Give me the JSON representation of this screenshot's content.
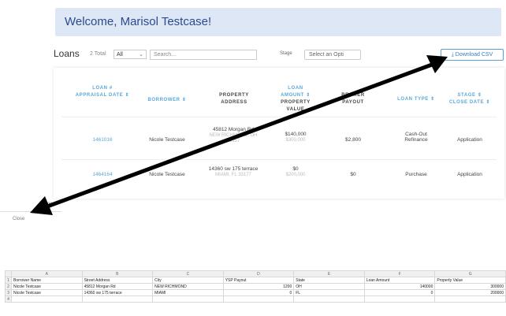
{
  "banner": {
    "welcome": "Welcome, Marisol Testcase!"
  },
  "toolbar": {
    "title": "Loans",
    "total": "2 Total",
    "filter_value": "All",
    "search_placeholder": "Search...",
    "stage_label": "Stage",
    "stage_placeholder": "Select an Opti",
    "download_label": "⤓ Download CSV"
  },
  "table": {
    "headers": [
      {
        "l1": "LOAN #",
        "l2": "APPRAISAL DATE ⇕"
      },
      {
        "l1": "BORROWER ⇕",
        "l2": ""
      },
      {
        "l1": "PROPERTY",
        "l2": "ADDRESS"
      },
      {
        "l1": "LOAN",
        "l2": "AMOUNT ⇕",
        "l3": "PROPERTY",
        "l4": "VALUE"
      },
      {
        "l1": "BROKER",
        "l2": "PAYOUT"
      },
      {
        "l1": "LOAN TYPE ⇕",
        "l2": ""
      },
      {
        "l1": "STAGE ⇕",
        "l2": "CLOSE DATE ⇕"
      }
    ],
    "rows": [
      {
        "loan_id": "1461016",
        "borrower": "Nicole Testcase",
        "address1": "45812 Morgan Rd",
        "address2": "NEW RICHMOND, OH",
        "address3": "45157",
        "amount": "$140,000",
        "value": "$300,000",
        "payout": "$2,800",
        "type1": "Cash-Out",
        "type2": "Refinance",
        "stage": "Application"
      },
      {
        "loan_id": "1464164",
        "borrower": "Nicole Testcase",
        "address1": "14360 sw 175 terrace",
        "address2": "MIAMI, FL 33177",
        "address3": "",
        "amount": "$0",
        "value": "$200,000",
        "payout": "$0",
        "type1": "Purchase",
        "type2": "",
        "stage": "Application"
      }
    ]
  },
  "fragments": {
    "left_text": "Close",
    "small_text": "Loans"
  },
  "spreadsheet": {
    "col_letters": [
      "A",
      "B",
      "C",
      "D",
      "E",
      "F",
      "G"
    ],
    "headers": [
      "Borrower Name",
      "Street Address",
      "City",
      "YSP Payout",
      "State",
      "Loan Amount",
      "Property Value"
    ],
    "rows": [
      [
        "Nicole Testcase",
        "45812 Morgan Rd",
        "NEW RICHMOND",
        "1200",
        "OH",
        "140000",
        "300000"
      ],
      [
        "Nicole Testcase",
        "14360 sw 175 terrace",
        "MIAMI",
        "0",
        "FL",
        "0",
        "200000"
      ]
    ]
  },
  "colors": {
    "accent": "#5aa8d8",
    "banner_bg": "#dde7f6",
    "banner_text": "#2c4a8c",
    "arrow": "#000000"
  }
}
